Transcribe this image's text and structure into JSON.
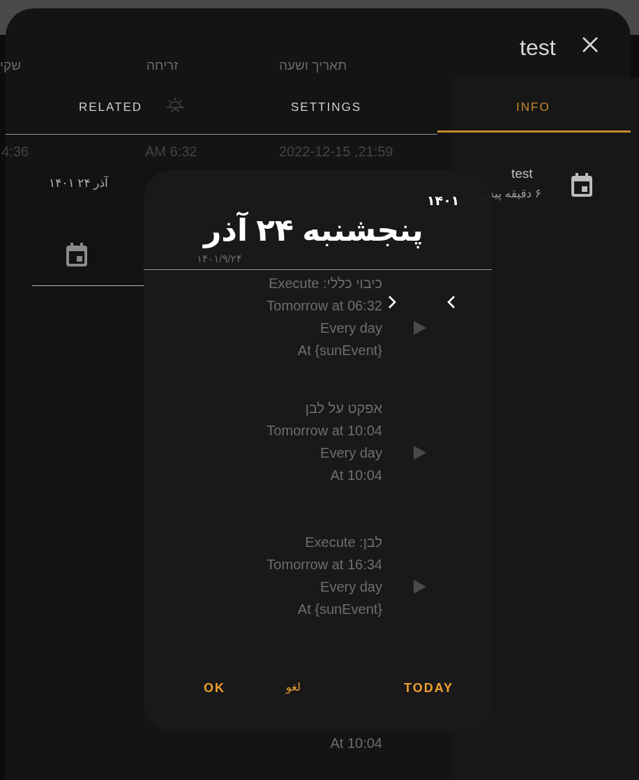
{
  "window": {
    "title": "test"
  },
  "table": {
    "columns": [
      "תאריך ושעה",
      "זריחה",
      "שקי"
    ],
    "row": [
      "2022-12-15 ,21:59",
      "AM 6:32",
      "4:36"
    ]
  },
  "tabs": [
    {
      "label": "INFO",
      "selected": true
    },
    {
      "label": "SETTINGS",
      "selected": false
    },
    {
      "label": "RELATED",
      "selected": false
    }
  ],
  "date_field": {
    "value": "آذر ۲۴ ۱۴۰۱"
  },
  "info": {
    "name": "test",
    "time": "۶ دقیقه پیش"
  },
  "automations": [
    {
      "title": "כיבוי כללי: Execute",
      "next": "Tomorrow at 06:32",
      "repeat": "Every day",
      "at": "At {sunEvent}"
    },
    {
      "title": "אפקט על לבן",
      "next": "Tomorrow at 10:04",
      "repeat": "Every day",
      "at": "At 10:04"
    },
    {
      "title": "לבן: Execute",
      "next": "Tomorrow at 16:34",
      "repeat": "Every day",
      "at": "At {sunEvent}"
    },
    {
      "at": "At 10:04"
    }
  ],
  "date_picker": {
    "year": "۱۴۰۱",
    "headline": "پنجشنبه ۲۴ آذر",
    "hint": "۱۴۰۱/۹/۲۴",
    "buttons": [
      "TODAY",
      "لغو",
      "OK"
    ]
  }
}
